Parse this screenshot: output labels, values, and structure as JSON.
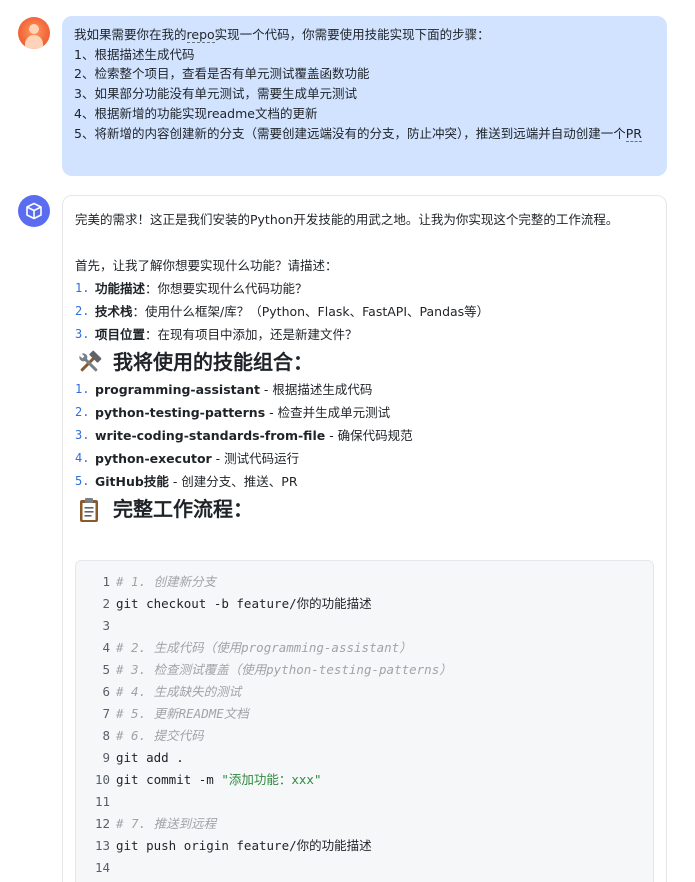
{
  "user_message": {
    "intro": "我如果需要你在我的repo实现一个代码，你需要使用技能实现下面的步骤：",
    "steps": [
      "1、根据描述生成代码",
      "2、检索整个项目，查看是否有单元测试覆盖函数功能",
      "3、如果部分功能没有单元测试，需要生成单元测试",
      "4、根据新增的功能实现readme文档的更新",
      "5、将新增的内容创建新的分支（需要创建远端没有的分支，防止冲突），推送到远端并自动创建一个PR"
    ]
  },
  "assistant_message": {
    "intro": "完美的需求！这正是我们安装的Python开发技能的用武之地。让我为你实现这个完整的工作流程。",
    "ask": "首先，让我了解你想要实现什么功能？请描述：",
    "questions": [
      {
        "num": "1.",
        "bold": "功能描述",
        "rest": "：你想要实现什么代码功能？"
      },
      {
        "num": "2.",
        "bold": "技术栈",
        "rest": "：使用什么框架/库？（Python、Flask、FastAPI、Pandas等）"
      },
      {
        "num": "3.",
        "bold": "项目位置",
        "rest": "：在现有项目中添加，还是新建文件？"
      }
    ],
    "skills_heading": "我将使用的技能组合：",
    "skills": [
      {
        "num": "1.",
        "bold": "programming-assistant",
        "rest": " - 根据描述生成代码"
      },
      {
        "num": "2.",
        "bold": "python-testing-patterns",
        "rest": " - 检查并生成单元测试"
      },
      {
        "num": "3.",
        "bold": "write-coding-standards-from-file",
        "rest": " - 确保代码规范"
      },
      {
        "num": "4.",
        "bold": "python-executor",
        "rest": " - 测试代码运行"
      },
      {
        "num": "5.",
        "bold": "GitHub技能",
        "rest": " - 创建分支、推送、PR"
      }
    ],
    "workflow_heading": "完整工作流程：",
    "code": [
      {
        "n": "1",
        "comment": "# 1. 创建新分支"
      },
      {
        "n": "2",
        "code": "git checkout -b feature/你的功能描述"
      },
      {
        "n": "3"
      },
      {
        "n": "4",
        "comment": "# 2. 生成代码（使用programming-assistant）"
      },
      {
        "n": "5",
        "comment": "# 3. 检查测试覆盖（使用python-testing-patterns）"
      },
      {
        "n": "6",
        "comment": "# 4. 生成缺失的测试"
      },
      {
        "n": "7",
        "comment": "# 5. 更新README文档"
      },
      {
        "n": "8",
        "comment": "# 6. 提交代码"
      },
      {
        "n": "9",
        "code": "git add ."
      },
      {
        "n": "10",
        "code": "git commit -m ",
        "string": "\"添加功能：xxx\""
      },
      {
        "n": "11"
      },
      {
        "n": "12",
        "comment": "# 7. 推送到远程"
      },
      {
        "n": "13",
        "code": "git push origin feature/你的功能描述"
      },
      {
        "n": "14"
      }
    ]
  },
  "colors": {
    "user_bubble": "#d1e3ff",
    "list_number": "#2f6fdb",
    "code_comment": "#a0a4a8",
    "code_string": "#2f8a3e",
    "bot_avatar": "#5a6df0"
  }
}
